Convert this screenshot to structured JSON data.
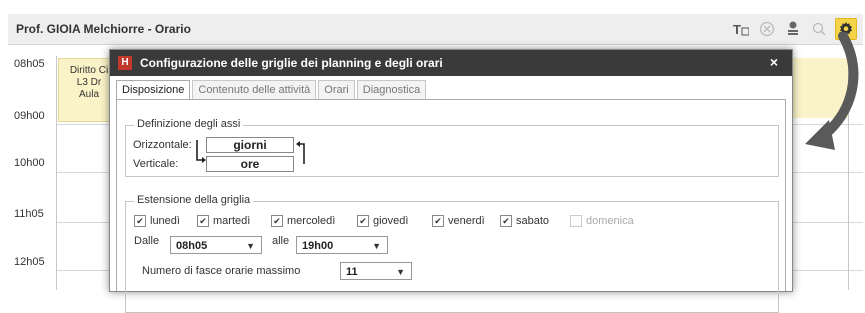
{
  "window": {
    "title": "Prof. GIOIA Melchiorre - Orario"
  },
  "toolbar_icons": [
    "text-format-icon",
    "close-circle-icon",
    "user-badge-icon",
    "search-icon",
    "gear-icon"
  ],
  "times": [
    "08h05",
    "09h00",
    "10h00",
    "11h05",
    "12h05"
  ],
  "course_card": {
    "line1": "Diritto Ci",
    "line2": "L3 Dr",
    "line3": "Aula"
  },
  "dialog": {
    "title": "Configurazione delle griglie dei planning e degli orari",
    "close": "×",
    "tabs": [
      "Disposizione",
      "Contenuto delle attività",
      "Orari",
      "Diagnostica"
    ],
    "assi": {
      "legend": "Definizione degli assi",
      "horizontal_label": "Orizzontale:",
      "horizontal_value": "giorni",
      "vertical_label": "Verticale:",
      "vertical_value": "ore"
    },
    "estensione": {
      "legend": "Estensione della griglia",
      "days": [
        {
          "label": "lunedì",
          "checked": true
        },
        {
          "label": "martedì",
          "checked": true
        },
        {
          "label": "mercoledì",
          "checked": true
        },
        {
          "label": "giovedì",
          "checked": true
        },
        {
          "label": "venerdì",
          "checked": true
        },
        {
          "label": "sabato",
          "checked": true
        },
        {
          "label": "domenica",
          "checked": false
        }
      ],
      "from_label": "Dalle",
      "from_value": "08h05",
      "to_label": "alle",
      "to_value": "19h00",
      "max_label": "Numero di fasce orarie massimo",
      "max_value": "11"
    }
  },
  "colors": {
    "accent": "#f5d44a",
    "dialog_title": "#3a3a3a",
    "logo": "#c0392b"
  }
}
